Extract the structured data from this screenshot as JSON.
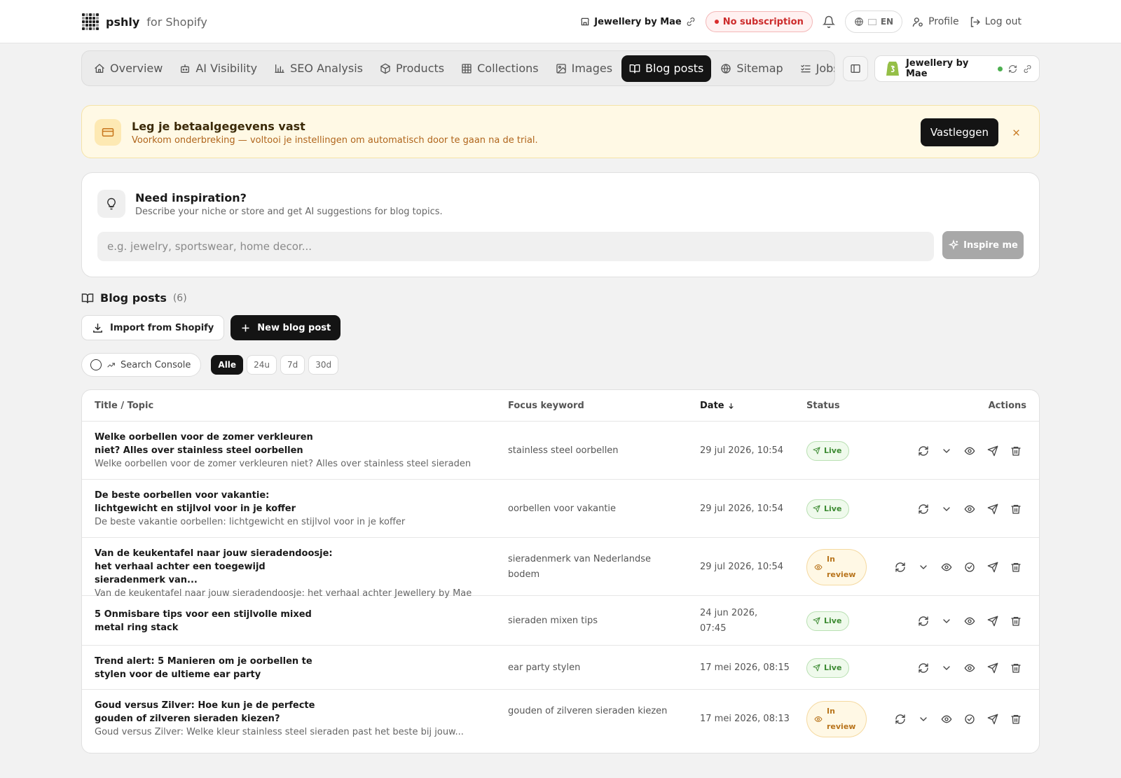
{
  "app": {
    "brand_name": "pshly",
    "brand_sub": "for Shopify"
  },
  "topbar": {
    "store_name": "Jewellery by Mae",
    "subscription_status": "No subscription",
    "language": "EN",
    "profile_label": "Profile",
    "logout_label": "Log out"
  },
  "nav": {
    "items": [
      {
        "label": "Overview",
        "icon": "home-icon"
      },
      {
        "label": "AI Visibility",
        "icon": "robot-icon"
      },
      {
        "label": "SEO Analysis",
        "icon": "bar-chart-icon"
      },
      {
        "label": "Products",
        "icon": "box-icon"
      },
      {
        "label": "Collections",
        "icon": "grid-icon"
      },
      {
        "label": "Images",
        "icon": "image-icon"
      },
      {
        "label": "Blog posts",
        "icon": "book-open-icon",
        "active": true
      },
      {
        "label": "Sitemap",
        "icon": "globe-icon"
      },
      {
        "label": "Jobs",
        "icon": "list-check-icon"
      }
    ],
    "store_pill_name": "Jewellery by Mae"
  },
  "banner": {
    "title": "Leg je betaalgegevens vast",
    "subtitle": "Voorkom onderbreking — voltooi je instellingen om automatisch door te gaan na de trial.",
    "button_label": "Vastleggen"
  },
  "inspire": {
    "title": "Need inspiration?",
    "subtitle": "Describe your niche or store and get AI suggestions for blog topics.",
    "placeholder": "e.g. jewelry, sportswear, home decor...",
    "value": "",
    "button_label": "Inspire me"
  },
  "posts_section": {
    "title": "Blog posts",
    "count": "(6)",
    "import_label": "Import from Shopify",
    "new_label": "New blog post",
    "search_console_label": "Search Console",
    "ranges": [
      "Alle",
      "24u",
      "7d",
      "30d"
    ],
    "active_range": "Alle"
  },
  "table": {
    "columns": {
      "title": "Title / Topic",
      "keyword": "Focus keyword",
      "date": "Date",
      "status": "Status",
      "actions": "Actions"
    },
    "rows": [
      {
        "title": "Welke oorbellen voor de zomer verkleuren niet? Alles over stainless steel oorbellen",
        "subtitle": "Welke oorbellen voor de zomer verkleuren niet? Alles over stainless steel sieraden",
        "keyword": "stainless steel oorbellen",
        "date": "29 jul 2026, 10:54",
        "status": "Live"
      },
      {
        "title": "De beste oorbellen voor vakantie: lichtgewicht en stijlvol voor in je koffer",
        "subtitle": "De beste vakantie oorbellen: lichtgewicht en stijlvol voor in je koffer",
        "keyword": "oorbellen voor vakantie",
        "date": "29 jul 2026, 10:54",
        "status": "Live"
      },
      {
        "title": "Van de keukentafel naar jouw sieradendoosje: het verhaal achter een toegewijd sieradenmerk van...",
        "subtitle": "Van de keukentafel naar jouw sieradendoosje: het verhaal achter Jewellery by Mae",
        "keyword": "sieradenmerk van Nederlandse bodem",
        "date": "29 jul 2026, 10:54",
        "status": "In review"
      },
      {
        "title": "5 Onmisbare tips voor een stijlvolle mixed metal ring stack",
        "subtitle": "",
        "keyword": "sieraden mixen tips",
        "date": "24 jun 2026, 07:45",
        "status": "Live"
      },
      {
        "title": "Trend alert: 5 Manieren om je oorbellen te stylen voor de ultieme ear party",
        "subtitle": "",
        "keyword": "ear party stylen",
        "date": "17 mei 2026, 08:15",
        "status": "Live"
      },
      {
        "title": "Goud versus Zilver: Hoe kun je de perfecte gouden of zilveren sieraden kiezen?",
        "subtitle": "Goud versus Zilver: Welke kleur stainless steel sieraden past het beste bij jouw...",
        "keyword": "gouden of zilveren sieraden kiezen",
        "date": "17 mei 2026, 08:13",
        "status": "In review"
      }
    ]
  },
  "colors": {
    "dark": "#141414",
    "live_green": "#3d8b33",
    "review_amber": "#b8741c",
    "alert_red": "#cc2b2b",
    "banner_bg": "#fff9e5"
  }
}
